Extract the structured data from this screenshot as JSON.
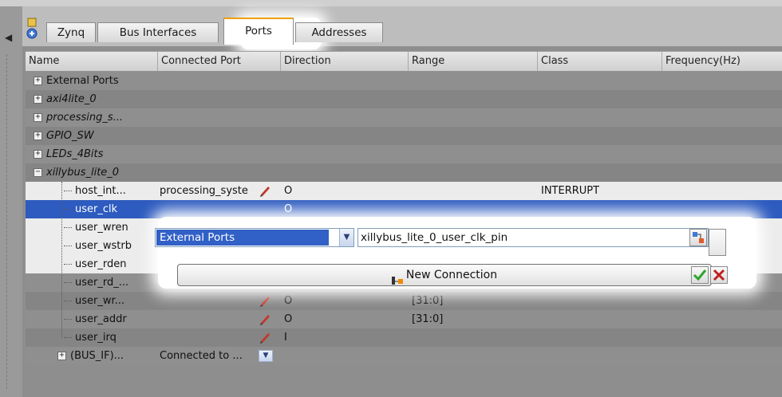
{
  "tabs": [
    "Zynq",
    "Bus Interfaces",
    "Ports",
    "Addresses"
  ],
  "active_tab": "Ports",
  "columns": [
    "Name",
    "Connected Port",
    "Direction",
    "Range",
    "Class",
    "Frequency(Hz)"
  ],
  "groups": [
    {
      "label": "External Ports",
      "italic": false,
      "expander": "+"
    },
    {
      "label": "axi4lite_0",
      "italic": true,
      "expander": "+"
    },
    {
      "label": "processing_s...",
      "italic": true,
      "expander": "+"
    },
    {
      "label": "GPIO_SW",
      "italic": true,
      "expander": "+"
    },
    {
      "label": "LEDs_4Bits",
      "italic": true,
      "expander": "+"
    },
    {
      "label": "xillybus_lite_0",
      "italic": true,
      "expander": "−"
    }
  ],
  "ports": [
    {
      "name": "host_int...",
      "connected": "processing_syste",
      "direction": "O",
      "range": "",
      "class": "INTERRUPT"
    },
    {
      "name": "user_clk",
      "connected": "",
      "direction": "O",
      "range": "",
      "class": ""
    },
    {
      "name": "user_wren",
      "connected": "",
      "direction": "",
      "range": "",
      "class": ""
    },
    {
      "name": "user_wstrb",
      "connected": "",
      "direction": "",
      "range": "",
      "class": ""
    },
    {
      "name": "user_rden",
      "connected": "",
      "direction": "",
      "range": "",
      "class": ""
    },
    {
      "name": "user_rd_...",
      "connected": "",
      "direction": "I",
      "range": "[31:0]",
      "class": ""
    },
    {
      "name": "user_wr...",
      "connected": "",
      "direction": "O",
      "range": "[31:0]",
      "class": ""
    },
    {
      "name": "user_addr",
      "connected": "",
      "direction": "O",
      "range": "[31:0]",
      "class": ""
    },
    {
      "name": "user_irq",
      "connected": "",
      "direction": "I",
      "range": "",
      "class": ""
    }
  ],
  "bus_if": {
    "name": "(BUS_IF)...",
    "connected": "Connected to ..."
  },
  "editor": {
    "source_combo": "External Ports",
    "target_combo": "xillybus_lite_0_user_clk_pin",
    "new_connection": "New Connection"
  },
  "icons": {
    "collapse": "chevron-left-icon",
    "add": "add-component-icon",
    "edit": "pencil-icon",
    "accept": "checkmark-icon",
    "cancel": "x-mark-icon",
    "new_conn": "new-connection-icon",
    "dropdown": "chevron-down-icon"
  },
  "colors": {
    "selection": "#2d5bbf",
    "accept": "#2fa52f",
    "cancel": "#c02020",
    "active_tab": "#f0a000"
  }
}
